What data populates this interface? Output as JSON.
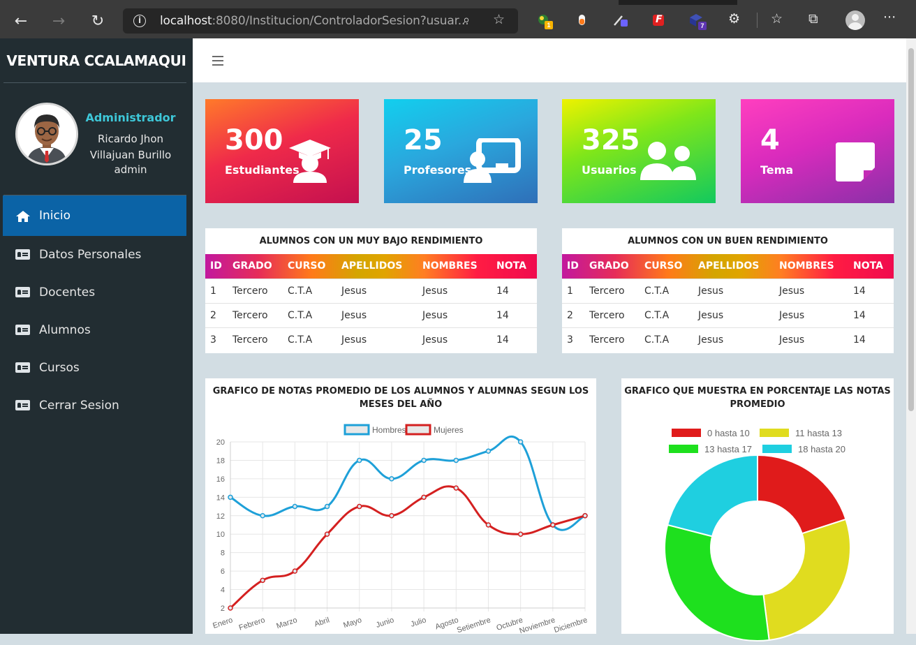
{
  "browser": {
    "url_host": "localhost",
    "url_rest": ":8080/Institucion/ControladorSesion?usuar...",
    "ext_badge_1": "1",
    "ext_badge_2": "7",
    "ext_f": "F",
    "more": "···"
  },
  "sidebar": {
    "brand": "VENTURA CCALAMAQUI",
    "user": {
      "role": "Administrador",
      "name_1": "Ricardo Jhon",
      "name_2": "Villajuan Burillo",
      "login": "admin"
    },
    "items": [
      {
        "label": "Inicio",
        "icon": "home-icon"
      },
      {
        "label": "Datos Personales",
        "icon": "id-card-icon"
      },
      {
        "label": "Docentes",
        "icon": "id-card-icon"
      },
      {
        "label": "Alumnos",
        "icon": "id-card-icon"
      },
      {
        "label": "Cursos",
        "icon": "id-card-icon"
      },
      {
        "label": "Cerrar Sesion",
        "icon": "id-card-icon"
      }
    ]
  },
  "stats": [
    {
      "value": "300",
      "label": "Estudiantes",
      "icon": "graduate-icon"
    },
    {
      "value": "25",
      "label": "Profesores",
      "icon": "teacher-board-icon"
    },
    {
      "value": "325",
      "label": "Usuarios",
      "icon": "users-icon"
    },
    {
      "value": "4",
      "label": "Tema",
      "icon": "sticky-note-icon"
    }
  ],
  "tables": {
    "low": {
      "title": "ALUMNOS CON UN MUY BAJO RENDIMIENTO",
      "headers": [
        "ID",
        "GRADO",
        "CURSO",
        "APELLIDOS",
        "NOMBRES",
        "NOTA"
      ],
      "rows": [
        [
          "1",
          "Tercero",
          "C.T.A",
          "Jesus",
          "Jesus",
          "14"
        ],
        [
          "2",
          "Tercero",
          "C.T.A",
          "Jesus",
          "Jesus",
          "14"
        ],
        [
          "3",
          "Tercero",
          "C.T.A",
          "Jesus",
          "Jesus",
          "14"
        ]
      ]
    },
    "high": {
      "title": "ALUMNOS CON UN BUEN RENDIMIENTO",
      "headers": [
        "ID",
        "GRADO",
        "CURSO",
        "APELLIDOS",
        "NOMBRES",
        "NOTA"
      ],
      "rows": [
        [
          "1",
          "Tercero",
          "C.T.A",
          "Jesus",
          "Jesus",
          "14"
        ],
        [
          "2",
          "Tercero",
          "C.T.A",
          "Jesus",
          "Jesus",
          "14"
        ],
        [
          "3",
          "Tercero",
          "C.T.A",
          "Jesus",
          "Jesus",
          "14"
        ]
      ]
    }
  },
  "line_panel": {
    "title_1": "GRAFICO DE NOTAS PROMEDIO DE LOS ALUMNOS Y ALUMNAS SEGUN LOS",
    "title_2": "MESES DEL AÑO"
  },
  "pie_panel": {
    "title_1": "GRAFICO QUE MUESTRA EN PORCENTAJE LAS NOTAS",
    "title_2": "PROMEDIO"
  },
  "chart_data": [
    {
      "type": "line",
      "categories": [
        "Enero",
        "Febrero",
        "Marzo",
        "Abril",
        "Mayo",
        "Junio",
        "Julio",
        "Agosto",
        "Setiembre",
        "Octubre",
        "Noviembre",
        "Diciembre"
      ],
      "series": [
        {
          "name": "Hombres",
          "color": "#1ea0d8",
          "values": [
            14,
            12,
            13,
            13,
            18,
            16,
            18,
            18,
            19,
            20,
            11,
            12
          ]
        },
        {
          "name": "Mujeres",
          "color": "#d42020",
          "values": [
            2,
            5,
            6,
            10,
            13,
            12,
            14,
            15,
            11,
            10,
            11,
            12
          ]
        }
      ],
      "ylim": [
        2,
        20
      ],
      "yticks": [
        2,
        4,
        6,
        8,
        10,
        12,
        14,
        16,
        18,
        20
      ],
      "grid": true,
      "legend": "top"
    },
    {
      "type": "pie",
      "donut": true,
      "categories": [
        "0 hasta 10",
        "11 hasta 13",
        "13 hasta 17",
        "18 hasta 20"
      ],
      "values": [
        20,
        28,
        31,
        21
      ],
      "colors": [
        "#e01b1b",
        "#e0dc1f",
        "#1ee01e",
        "#1fcfe0"
      ],
      "legend": "top"
    }
  ]
}
